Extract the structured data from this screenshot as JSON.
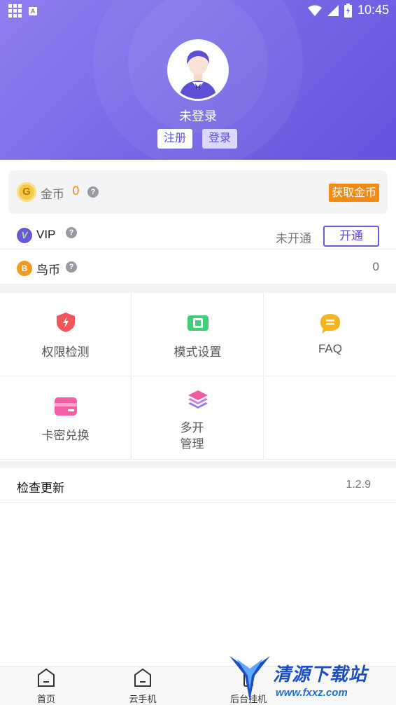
{
  "status_bar": {
    "time": "10:45",
    "notification_icons": [
      "grid-icon",
      "a-icon"
    ],
    "system_icons": [
      "wifi-icon",
      "signal-icon",
      "battery-charging-icon"
    ]
  },
  "profile": {
    "state_text": "未登录",
    "register_label": "注册",
    "login_label": "登录"
  },
  "coins": {
    "icon_letter": "G",
    "label": "金币",
    "value": "0",
    "get_button": "获取金币"
  },
  "vip": {
    "icon_letter": "V",
    "label": "VIP",
    "status": "未开通",
    "open_button": "开通"
  },
  "bird_coin": {
    "icon_letter": "B",
    "label": "鸟币",
    "value": "0"
  },
  "features": [
    {
      "label": "权限检测",
      "icon": "shield-alert-icon"
    },
    {
      "label": "模式设置",
      "icon": "mode-device-icon"
    },
    {
      "label": "FAQ",
      "icon": "chat-bubble-icon"
    },
    {
      "label": "卡密兑换",
      "icon": "card-icon"
    },
    {
      "label_line1": "多开",
      "label_line2": "管理",
      "icon": "layers-icon"
    }
  ],
  "update": {
    "label": "检查更新",
    "version": "1.2.9"
  },
  "bottom_nav": [
    {
      "label": "首页",
      "icon": "home-icon"
    },
    {
      "label": "云手机",
      "icon": "cloud-phone-icon"
    },
    {
      "label": "后台挂机",
      "icon": "background-icon"
    }
  ],
  "watermark": {
    "text": "清源下载站",
    "sub": "www.fxxz.com"
  },
  "colors": {
    "header_start": "#8f7ff0",
    "header_end": "#6454dc",
    "accent": "#6a58d8",
    "coin_orange": "#f28a14"
  }
}
